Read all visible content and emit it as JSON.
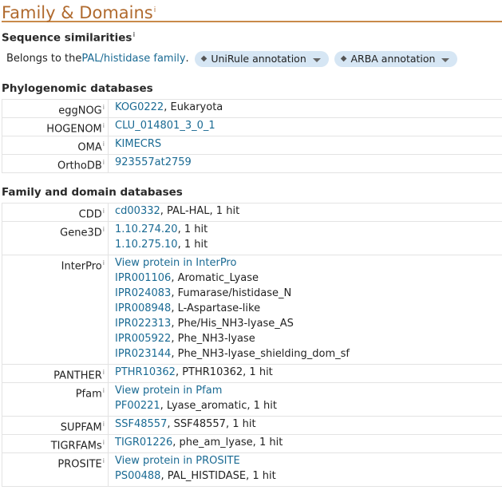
{
  "section_title": "Family & Domains",
  "info_mark": "i",
  "sequence_similarities": {
    "heading": "Sequence similarities",
    "text_before": "Belongs to the ",
    "link": "PAL/histidase family",
    "text_after": ".",
    "pills": [
      "UniRule annotation",
      "ARBA annotation"
    ]
  },
  "phylogenomic": {
    "heading": "Phylogenomic databases",
    "rows": [
      {
        "key": "eggNOG",
        "lines": [
          {
            "link": "KOG0222",
            "text": ", Eukaryota"
          }
        ]
      },
      {
        "key": "HOGENOM",
        "lines": [
          {
            "link": "CLU_014801_3_0_1",
            "text": ""
          }
        ]
      },
      {
        "key": "OMA",
        "lines": [
          {
            "link": "KIMECRS",
            "text": ""
          }
        ]
      },
      {
        "key": "OrthoDB",
        "lines": [
          {
            "link": "923557at2759",
            "text": ""
          }
        ]
      }
    ]
  },
  "family_domain": {
    "heading": "Family and domain databases",
    "rows": [
      {
        "key": "CDD",
        "lines": [
          {
            "link": "cd00332",
            "text": ", PAL-HAL, 1 hit"
          }
        ]
      },
      {
        "key": "Gene3D",
        "lines": [
          {
            "link": "1.10.274.20",
            "text": ", 1 hit"
          },
          {
            "link": "1.10.275.10",
            "text": ", 1 hit"
          }
        ]
      },
      {
        "key": "InterPro",
        "lines": [
          {
            "link": "View protein in InterPro",
            "text": ""
          },
          {
            "link": "IPR001106",
            "text": ", Aromatic_Lyase"
          },
          {
            "link": "IPR024083",
            "text": ", Fumarase/histidase_N"
          },
          {
            "link": "IPR008948",
            "text": ", L-Aspartase-like"
          },
          {
            "link": "IPR022313",
            "text": ", Phe/His_NH3-lyase_AS"
          },
          {
            "link": "IPR005922",
            "text": ", Phe_NH3-lyase"
          },
          {
            "link": "IPR023144",
            "text": ", Phe_NH3-lyase_shielding_dom_sf"
          }
        ]
      },
      {
        "key": "PANTHER",
        "lines": [
          {
            "link": "PTHR10362",
            "text": ", PTHR10362, 1 hit"
          }
        ]
      },
      {
        "key": "Pfam",
        "lines": [
          {
            "link": "View protein in Pfam",
            "text": ""
          },
          {
            "link": "PF00221",
            "text": ", Lyase_aromatic, 1 hit"
          }
        ]
      },
      {
        "key": "SUPFAM",
        "lines": [
          {
            "link": "SSF48557",
            "text": ", SSF48557, 1 hit"
          }
        ]
      },
      {
        "key": "TIGRFAMs",
        "lines": [
          {
            "link": "TIGR01226",
            "text": ", phe_am_lyase, 1 hit"
          }
        ]
      },
      {
        "key": "PROSITE",
        "lines": [
          {
            "link": "View protein in PROSITE",
            "text": ""
          },
          {
            "link": "PS00488",
            "text": ", PAL_HISTIDASE, 1 hit"
          }
        ]
      }
    ]
  },
  "colors": {
    "link": "#1a6a93",
    "title": "#b06a2e",
    "pill_bg": "#d6e6f4"
  }
}
